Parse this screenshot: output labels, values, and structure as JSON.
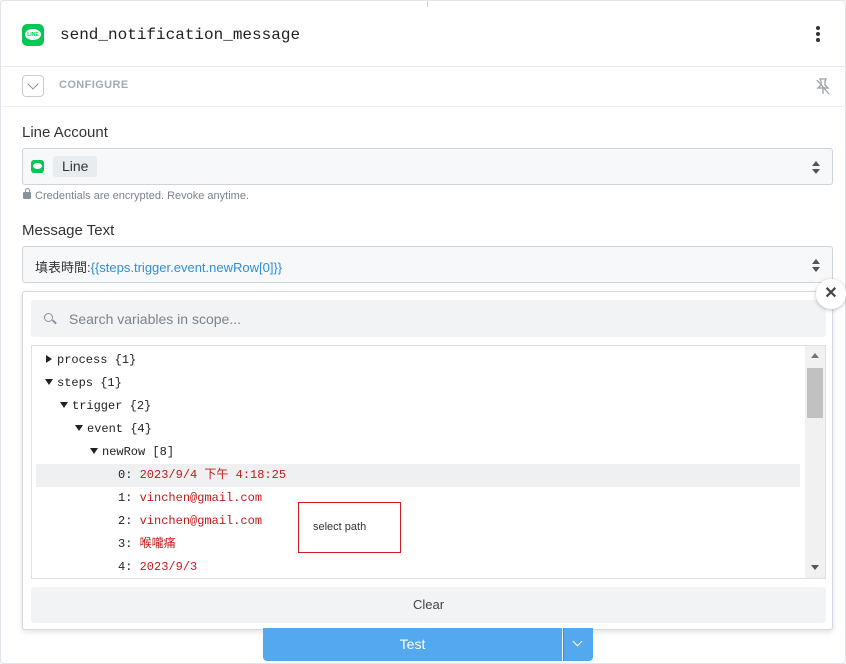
{
  "header": {
    "title": "send_notification_message",
    "logo_text": "LINE"
  },
  "configure": {
    "label": "CONFIGURE"
  },
  "line_account": {
    "label": "Line Account",
    "selected": "Line",
    "credentials_note": "Credentials are encrypted. Revoke anytime."
  },
  "message_text": {
    "label": "Message Text",
    "prefix": "填表時間:",
    "variable": "{{steps.trigger.event.newRow[0]}}"
  },
  "variables_popup": {
    "close_symbol": "✕",
    "search_placeholder": "Search variables in scope...",
    "tree": [
      {
        "key": "process",
        "suffix": "{1}",
        "state": "collapsed"
      },
      {
        "key": "steps",
        "suffix": "{1}",
        "state": "expanded"
      },
      {
        "key": "trigger",
        "suffix": "{2}",
        "state": "expanded"
      },
      {
        "key": "event",
        "suffix": "{4}",
        "state": "expanded"
      },
      {
        "key": "newRow",
        "suffix": "[8]",
        "state": "expanded"
      },
      {
        "key": "0:",
        "value": "2023/9/4 下午 4:18:25"
      },
      {
        "key": "1:",
        "value": "vinchen@gmail.com"
      },
      {
        "key": "2:",
        "value": "vinchen@gmail.com"
      },
      {
        "key": "3:",
        "value": "喉嚨痛"
      },
      {
        "key": "4:",
        "value": "2023/9/3"
      }
    ],
    "tooltip": "select path",
    "clear_label": "Clear"
  },
  "footer": {
    "test_label": "Test"
  },
  "colors": {
    "line_green": "#06c755",
    "accent_blue": "#54a9ee",
    "value_red": "#c41a1a",
    "variable_blue": "#2f8fd8"
  }
}
